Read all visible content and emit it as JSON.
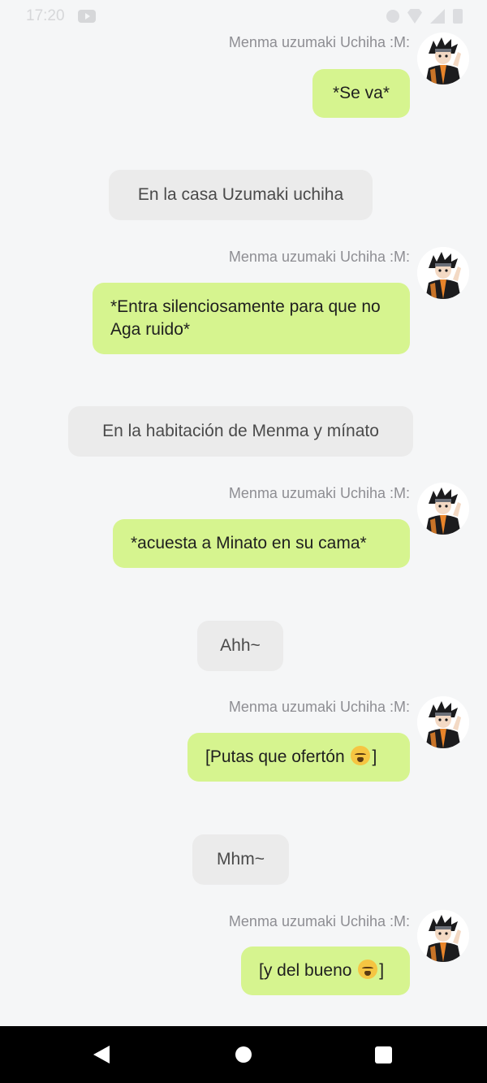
{
  "status_bar": {
    "time": "17:20",
    "icons": [
      "youtube-icon",
      "vibrate-icon",
      "wifi-icon",
      "signal-icon",
      "battery-icon"
    ]
  },
  "sender_name": "Menma uzumaki Uchiha :M:",
  "messages": [
    {
      "type": "out",
      "text": "*Se va*"
    },
    {
      "type": "narration",
      "text": "En la casa Uzumaki uchiha"
    },
    {
      "type": "out",
      "text": "*Entra silenciosamente para que no Aga ruido*"
    },
    {
      "type": "narration",
      "text": "En la habitación de Menma y mínato"
    },
    {
      "type": "out",
      "text": "*acuesta a Minato en su cama*"
    },
    {
      "type": "narration",
      "text": "Ahh~"
    },
    {
      "type": "out",
      "text": "[Putas que ofertón",
      "emoji": "weary-face-emoji",
      "suffix": "]"
    },
    {
      "type": "narration",
      "text": "Mhm~"
    },
    {
      "type": "out",
      "text": "[y del bueno",
      "emoji": "weary-face-emoji",
      "suffix": "]"
    }
  ],
  "colors": {
    "background": "#f5f6f7",
    "outgoing_bubble": "#d6f48f",
    "narration_bubble": "#ebebeb",
    "sender_name": "#8e8e93",
    "nav_bar": "#000000"
  },
  "nav": {
    "buttons": [
      "back-icon",
      "home-icon",
      "recents-icon"
    ]
  }
}
